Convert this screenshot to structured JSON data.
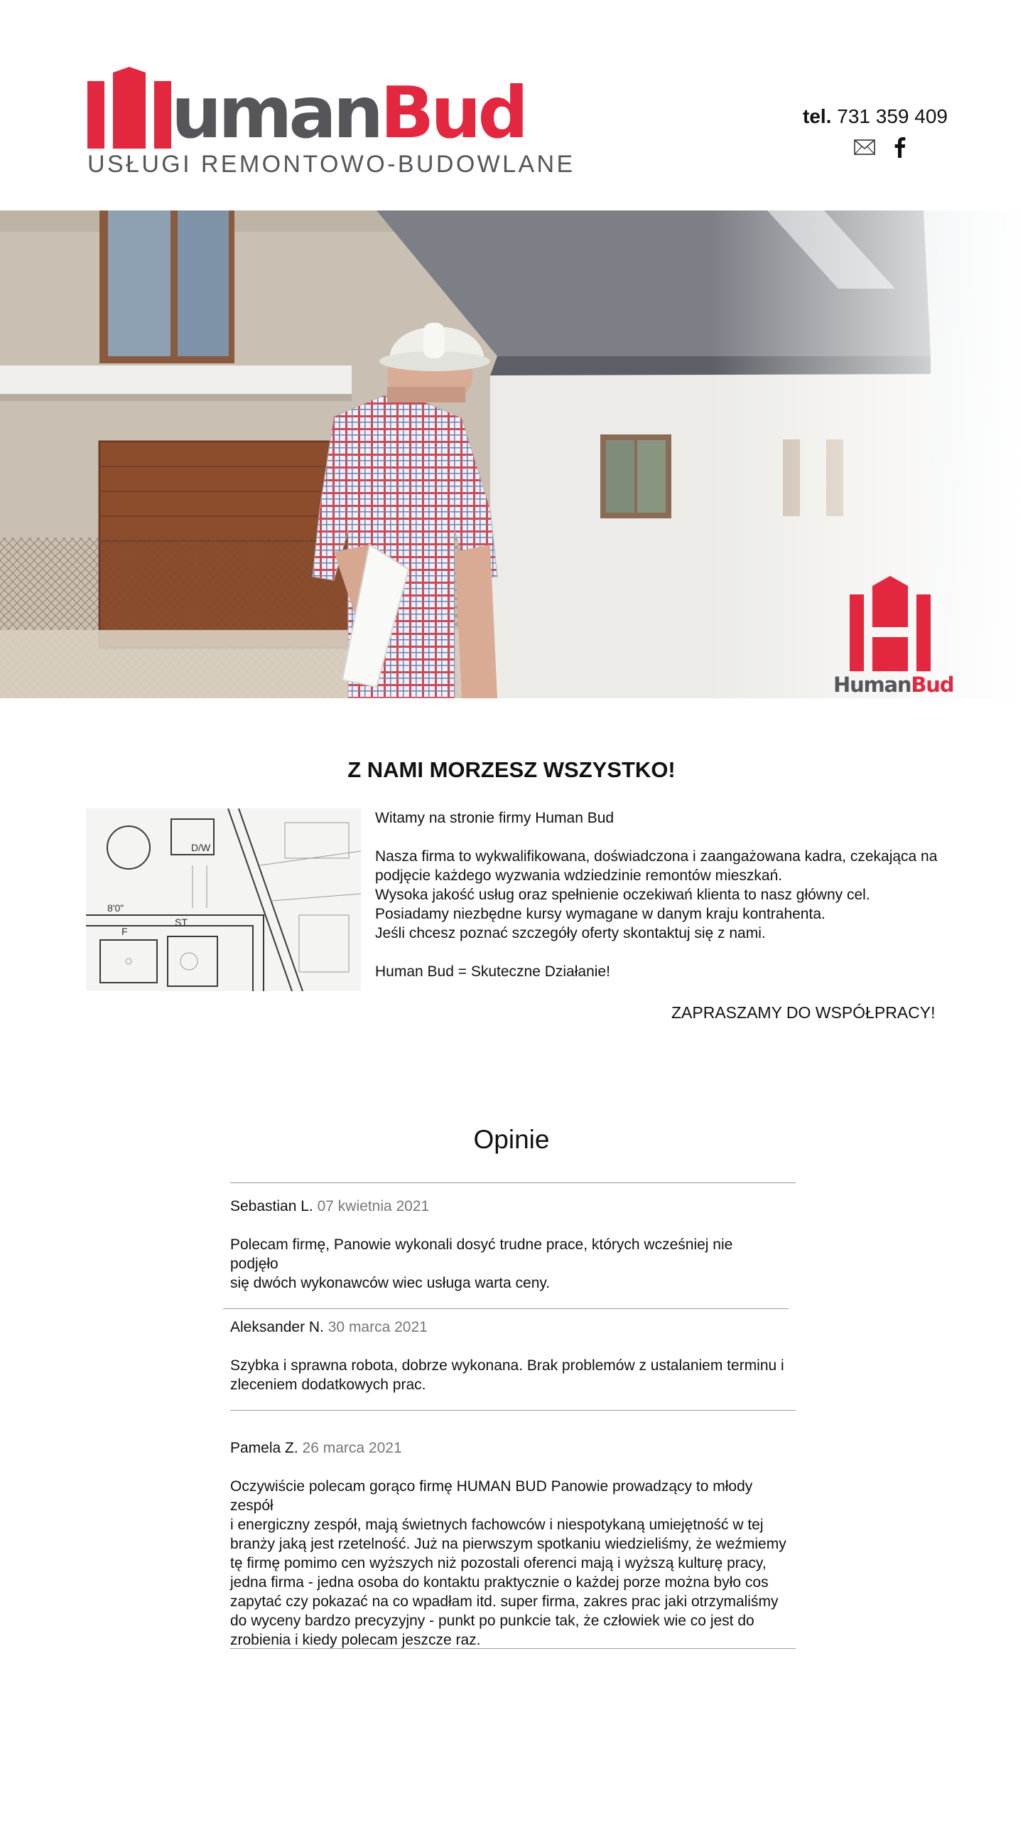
{
  "brand": {
    "name_part1": "uman",
    "name_part2": "Bud",
    "tagline": "USŁUGI REMONTOWO-BUDOWLANE",
    "badge_text_part1": "Human",
    "badge_text_part2": "Bud",
    "colors": {
      "red": "#e3273e",
      "gray": "#56565a"
    }
  },
  "contact": {
    "tel_label": "tel.",
    "tel_number": "731 359 409",
    "icons": [
      "mail-icon",
      "facebook-icon"
    ]
  },
  "intro": {
    "title": "Z NAMI MORZESZ WSZYSTKO!",
    "welcome": "Witamy na stronie firmy Human Bud",
    "lines": [
      "Nasza firma to wykwalifikowana, doświadczona i zaangażowana kadra, czekająca na",
      "podjęcie każdego wyzwania wdziedzinie remontów mieszkań.",
      "Wysoka jakość usług oraz spełnienie oczekiwań klienta to nasz główny cel.",
      "Posiadamy niezbędne kursy wymagane w danym kraju kontrahenta.",
      "Jeśli chcesz poznać szczegóły oferty skontaktuj się z nami."
    ],
    "motto": "Human Bud = Skuteczne Działanie!",
    "invite": "ZAPRASZAMY DO WSPÓŁPRACY!"
  },
  "opinions": {
    "title": "Opinie",
    "items": [
      {
        "author": "Sebastian L.",
        "date": "07 kwietnia 2021",
        "lines": [
          "Polecam firmę, Panowie wykonali dosyć trudne prace, których wcześniej nie",
          "podjęło",
          "się dwóch wykonawców wiec usługa warta ceny."
        ]
      },
      {
        "author": "Aleksander N.",
        "date": "30 marca 2021",
        "lines": [
          "Szybka i sprawna robota, dobrze wykonana. Brak problemów z ustalaniem terminu i",
          "zleceniem dodatkowych prac."
        ]
      },
      {
        "author": "Pamela Z.",
        "date": "26 marca 2021",
        "lines": [
          "Oczywiście polecam gorąco firmę HUMAN BUD Panowie prowadzący to młody zespół",
          "i energiczny zespół, mają świetnych fachowców i niespotykaną umiejętność w tej",
          "branży jaką jest rzetelność. Już na pierwszym spotkaniu wiedzieliśmy, że weźmiemy",
          "tę firmę pomimo cen wyższych niż pozostali oferenci mają i wyższą kulturę pracy,",
          "jedna firma - jedna osoba do kontaktu praktycznie o każdej porze można było cos",
          "zapytać czy pokazać na co wpadłam itd. super firma, zakres prac jaki otrzymaliśmy",
          "do wyceny bardzo precyzyjny - punkt po punkcie tak, że człowiek wie co jest do",
          "zrobienia i kiedy polecam jeszcze raz."
        ]
      }
    ]
  }
}
